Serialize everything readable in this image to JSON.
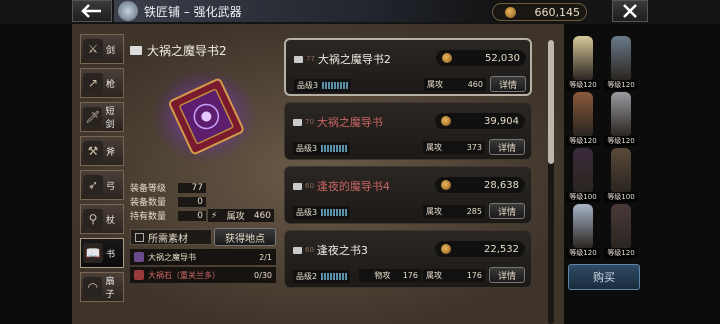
{
  "header": {
    "title": "铁匠铺 – 强化武器",
    "currency": "660,145"
  },
  "categories": [
    {
      "label": "剑",
      "icon": "sword-icon",
      "glyph": "⚔"
    },
    {
      "label": "枪",
      "icon": "spear-icon",
      "glyph": "↗"
    },
    {
      "label": "短剑",
      "icon": "dagger-icon",
      "glyph": "🗡"
    },
    {
      "label": "斧",
      "icon": "axe-icon",
      "glyph": "⚒"
    },
    {
      "label": "弓",
      "icon": "bow-icon",
      "glyph": "➶"
    },
    {
      "label": "杖",
      "icon": "staff-icon",
      "glyph": "⚲"
    },
    {
      "label": "书",
      "icon": "book-icon",
      "glyph": "📖"
    },
    {
      "label": "扇子",
      "icon": "fan-icon",
      "glyph": "◠"
    }
  ],
  "detail": {
    "name": "大祸之魔导书2",
    "stats": [
      {
        "label": "装备等级",
        "value": "77"
      },
      {
        "label": "装备数量",
        "value": "0"
      },
      {
        "label": "持有数量",
        "value": "0"
      }
    ],
    "attack_label": "属攻",
    "attack_value": "460",
    "materials_label": "所需素材",
    "get_button": "获得地点",
    "materials": [
      {
        "name": "大祸之魔导书",
        "count": "2/1",
        "color": "#e6dcc8"
      },
      {
        "name": "大祸石（重关兰多）",
        "count": "0/30",
        "color": "#d06a6a"
      }
    ]
  },
  "items": [
    {
      "level": "77",
      "name": "大祸之魔导书2",
      "price": "52,030",
      "grade": "品级3",
      "stat1_label": "属攻",
      "stat1_value": "460",
      "detail": "详情"
    },
    {
      "level": "70",
      "name": "大祸之魔导书",
      "price": "39,904",
      "grade": "品级3",
      "stat1_label": "属攻",
      "stat1_value": "373",
      "detail": "详情"
    },
    {
      "level": "60",
      "name": "逢夜的魔导书4",
      "price": "28,638",
      "grade": "品级3",
      "stat1_label": "属攻",
      "stat1_value": "285",
      "detail": "详情"
    },
    {
      "level": "60",
      "name": "逢夜之书3",
      "price": "22,532",
      "grade": "品级2",
      "stat0_label": "物攻",
      "stat0_value": "176",
      "stat1_label": "属攻",
      "stat1_value": "176",
      "detail": "详情"
    }
  ],
  "party": [
    {
      "level": "等级120"
    },
    {
      "level": "等级120"
    },
    {
      "level": "等级120"
    },
    {
      "level": "等级120"
    },
    {
      "level": "等级100"
    },
    {
      "level": "等级100"
    },
    {
      "level": "等级120"
    },
    {
      "level": "等级120"
    }
  ],
  "buy_button": "购买",
  "colors": {
    "accent": "#b6b1a4",
    "locked_name": "#c86464",
    "buy": "#2f4c67"
  }
}
